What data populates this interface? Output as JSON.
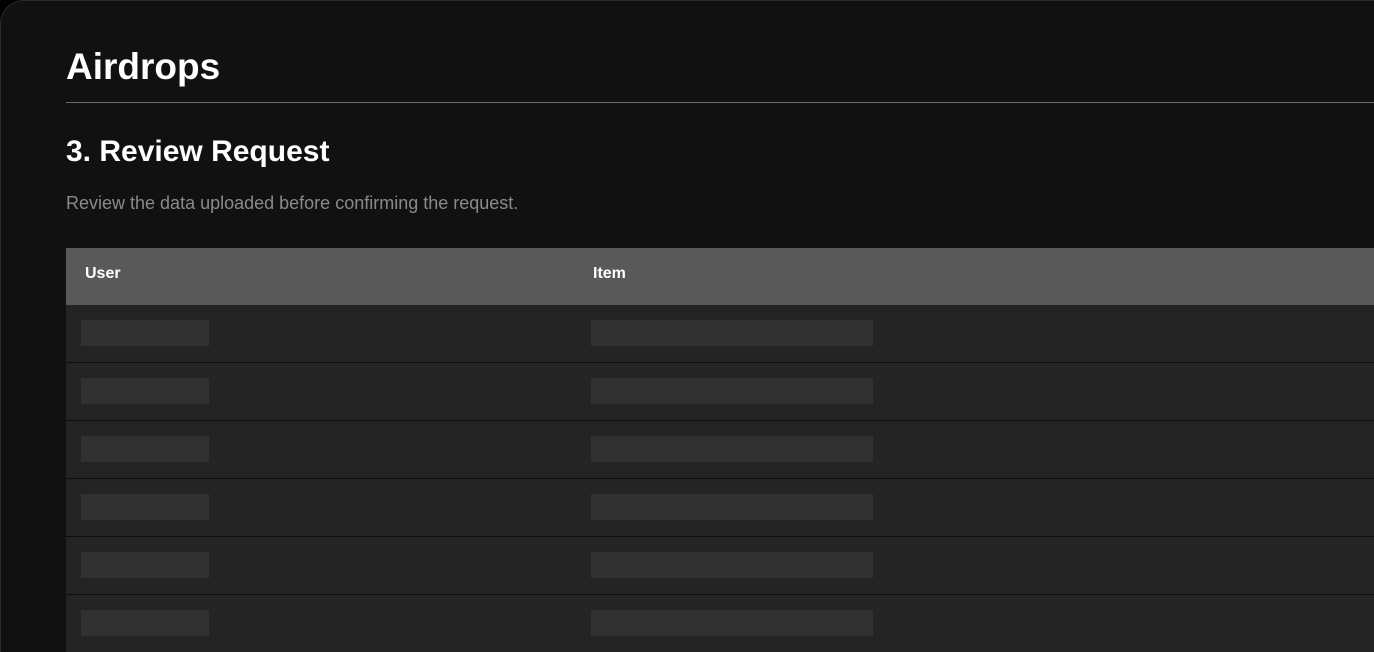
{
  "page": {
    "title": "Airdrops"
  },
  "section": {
    "title": "3. Review Request",
    "description": "Review the data uploaded before confirming the request."
  },
  "table": {
    "columns": [
      {
        "label": "User"
      },
      {
        "label": "Item"
      }
    ],
    "rows_loading": 6
  },
  "colors": {
    "background": "#111111",
    "header_background": "#595959",
    "row_background": "#242424",
    "skeleton": "#313131",
    "muted_text": "#8a8a8a"
  }
}
